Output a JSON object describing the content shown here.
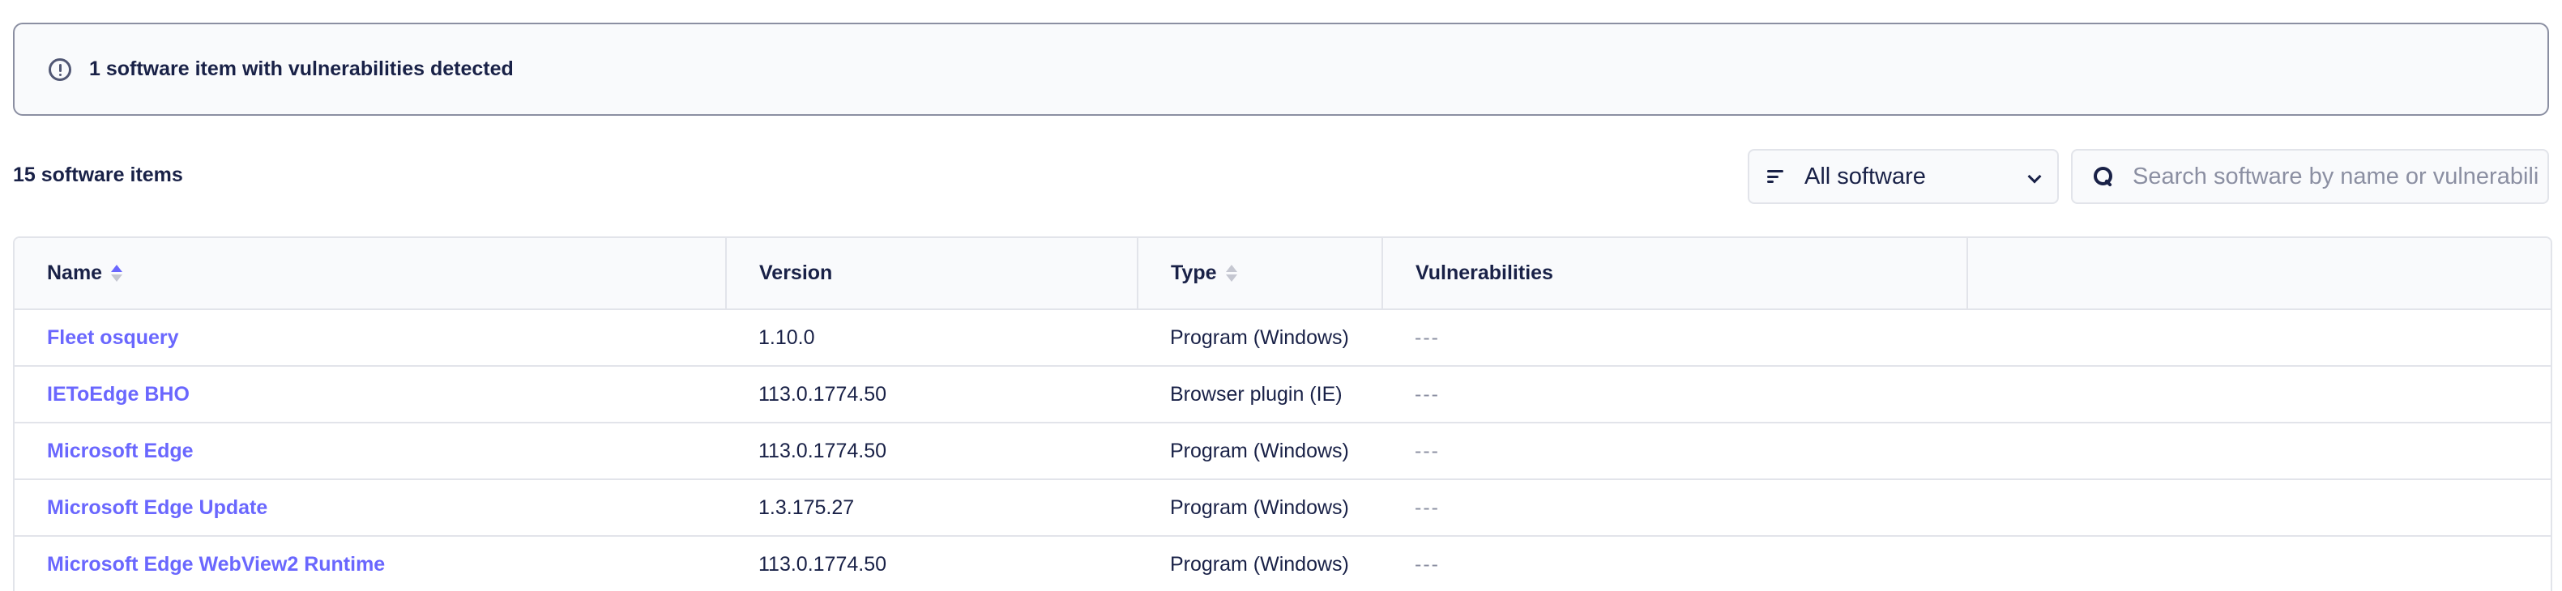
{
  "banner": {
    "icon": "info-circle-icon",
    "text": "1 software item with vulnerabilities detected"
  },
  "toolbar": {
    "count_label": "15 software items",
    "filter": {
      "icon": "filter-lines-icon",
      "selected": "All software"
    },
    "search": {
      "placeholder": "Search software by name or vulnerabilities (CVEs)",
      "value": ""
    }
  },
  "table": {
    "columns": [
      {
        "label": "Name",
        "sortable": true,
        "sort": "asc"
      },
      {
        "label": "Version",
        "sortable": false
      },
      {
        "label": "Type",
        "sortable": true,
        "sort": "none"
      },
      {
        "label": "Vulnerabilities",
        "sortable": false
      },
      {
        "label": "",
        "sortable": false
      }
    ],
    "rows": [
      {
        "name": "Fleet osquery",
        "version": "1.10.0",
        "type": "Program (Windows)",
        "vulnerabilities": "---"
      },
      {
        "name": "IEToEdge BHO",
        "version": "113.0.1774.50",
        "type": "Browser plugin (IE)",
        "vulnerabilities": "---"
      },
      {
        "name": "Microsoft Edge",
        "version": "113.0.1774.50",
        "type": "Program (Windows)",
        "vulnerabilities": "---"
      },
      {
        "name": "Microsoft Edge Update",
        "version": "1.3.175.27",
        "type": "Program (Windows)",
        "vulnerabilities": "---"
      },
      {
        "name": "Microsoft Edge WebView2 Runtime",
        "version": "113.0.1774.50",
        "type": "Program (Windows)",
        "vulnerabilities": "---"
      }
    ]
  },
  "colors": {
    "link": "#6a67fe",
    "text": "#192147",
    "muted": "#8b8fa2",
    "border": "#e2e4ea",
    "surface": "#f9fafc"
  }
}
